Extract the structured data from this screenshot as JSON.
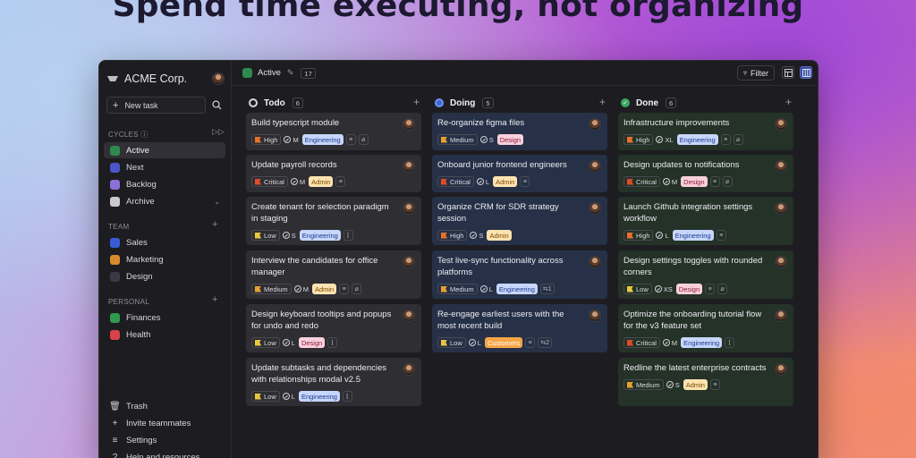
{
  "headline": "Spend time executing, not organizing",
  "workspace": {
    "name": "ACME Corp."
  },
  "sidebar": {
    "new_task_label": "New task",
    "cycles_label": "CYCLES",
    "cycles": [
      {
        "label": "Active",
        "icon": "cube-icon",
        "color": "#2e8a4f",
        "selected": true
      },
      {
        "label": "Next",
        "icon": "play-icon",
        "color": "#4b56c9"
      },
      {
        "label": "Backlog",
        "icon": "layers-icon",
        "color": "#8a72d8"
      },
      {
        "label": "Archive",
        "icon": "archive-icon",
        "color": "#c9c9cf"
      }
    ],
    "team_label": "TEAM",
    "teams": [
      {
        "label": "Sales",
        "icon": "chart-icon",
        "color": "#3b5bd6"
      },
      {
        "label": "Marketing",
        "icon": "megaphone-icon",
        "color": "#d88a2e"
      },
      {
        "label": "Design",
        "icon": "wand-icon",
        "color": "#3a3a44"
      }
    ],
    "personal_label": "PERSONAL",
    "personal": [
      {
        "label": "Finances",
        "icon": "dollar-icon",
        "color": "#2e9a4f"
      },
      {
        "label": "Health",
        "icon": "heart-icon",
        "color": "#d8424a"
      }
    ],
    "bottom": [
      {
        "label": "Trash",
        "icon": "trash-icon"
      },
      {
        "label": "Invite teammates",
        "icon": "user-plus-icon"
      },
      {
        "label": "Settings",
        "icon": "sliders-icon"
      },
      {
        "label": "Help and resources",
        "icon": "help-icon"
      }
    ]
  },
  "topbar": {
    "title": "Active",
    "count": "17",
    "filter_label": "Filter"
  },
  "label_colors": {
    "Engineering": {
      "bg": "#c7d6fb",
      "fg": "#1e3a8a"
    },
    "Admin": {
      "bg": "#fde3b0",
      "fg": "#7a4a00"
    },
    "Design": {
      "bg": "#f9d0dc",
      "fg": "#8a1e3a"
    },
    "Customers": {
      "bg": "#f5a545",
      "fg": "#ffffff"
    }
  },
  "priority_colors": {
    "High": "#e8702a",
    "Critical": "#e04a2a",
    "Medium": "#e8a030",
    "Low": "#e8c840"
  },
  "columns": [
    {
      "title": "Todo",
      "count": "6",
      "kind": "todo",
      "cards": [
        {
          "title": "Build typescript module",
          "priority": "High",
          "estimate": "M",
          "label": "Engineering",
          "extras": [
            "desc",
            "attach"
          ]
        },
        {
          "title": "Update payroll records",
          "priority": "Critical",
          "estimate": "M",
          "label": "Admin",
          "extras": [
            "desc"
          ]
        },
        {
          "title": "Create tenant for selection paradigm in staging",
          "priority": "Low",
          "estimate": "S",
          "label": "Engineering",
          "extras": [
            "sub"
          ]
        },
        {
          "title": "Interview the candidates for office manager",
          "priority": "Medium",
          "estimate": "M",
          "label": "Admin",
          "extras": [
            "desc",
            "attach"
          ]
        },
        {
          "title": "Design keyboard tooltips and popups for undo and redo",
          "priority": "Low",
          "estimate": "L",
          "label": "Design",
          "extras": [
            "sub"
          ]
        },
        {
          "title": "Update subtasks and dependencies with relationships modal v2.5",
          "priority": "Low",
          "estimate": "L",
          "label": "Engineering",
          "extras": [
            "sub"
          ]
        }
      ]
    },
    {
      "title": "Doing",
      "count": "5",
      "kind": "doing",
      "cards": [
        {
          "title": "Re-organize figma files",
          "priority": "Medium",
          "estimate": "S",
          "label": "Design",
          "extras": []
        },
        {
          "title": "Onboard junior frontend engineers",
          "priority": "Critical",
          "estimate": "L",
          "label": "Admin",
          "extras": [
            "desc"
          ]
        },
        {
          "title": "Organize CRM for SDR strategy session",
          "priority": "High",
          "estimate": "S",
          "label": "Admin",
          "extras": []
        },
        {
          "title": "Test live-sync functionality across platforms",
          "priority": "Medium",
          "estimate": "L",
          "label": "Engineering",
          "extras": [
            "subs:1"
          ]
        },
        {
          "title": "Re-engage earliest users with the most recent build",
          "priority": "Low",
          "estimate": "L",
          "label": "Customers",
          "extras": [
            "desc",
            "subs:2"
          ]
        }
      ]
    },
    {
      "title": "Done",
      "count": "6",
      "kind": "done",
      "cards": [
        {
          "title": "Infrastructure improvements",
          "priority": "High",
          "estimate": "XL",
          "label": "Engineering",
          "extras": [
            "desc",
            "attach"
          ]
        },
        {
          "title": "Design updates to notifications",
          "priority": "Critical",
          "estimate": "M",
          "label": "Design",
          "extras": [
            "desc",
            "attach"
          ]
        },
        {
          "title": "Launch Github integration settings workflow",
          "priority": "High",
          "estimate": "L",
          "label": "Engineering",
          "extras": [
            "desc"
          ]
        },
        {
          "title": "Design settings toggles with rounded corners",
          "priority": "Low",
          "estimate": "XS",
          "label": "Design",
          "extras": [
            "desc",
            "attach"
          ]
        },
        {
          "title": "Optimize the onboarding tutorial flow for the v3 feature set",
          "priority": "Critical",
          "estimate": "M",
          "label": "Engineering",
          "extras": [
            "sub"
          ]
        },
        {
          "title": "Redline the latest enterprise contracts",
          "priority": "Medium",
          "estimate": "S",
          "label": "Admin",
          "extras": [
            "desc"
          ]
        }
      ]
    }
  ]
}
